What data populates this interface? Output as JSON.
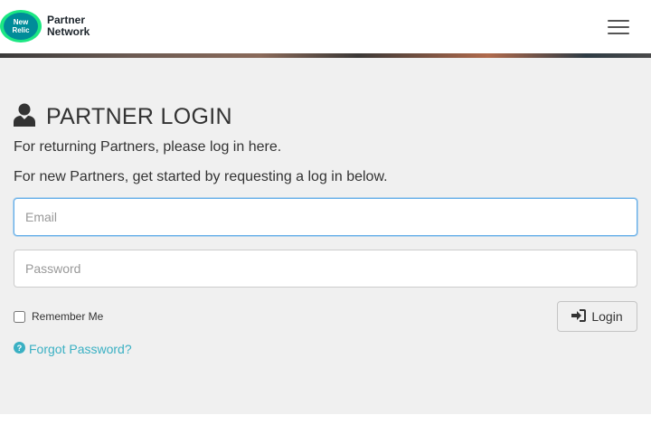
{
  "header": {
    "logo": {
      "badge_line1": "New",
      "badge_line2": "Relic",
      "name_line1": "Partner",
      "name_line2": "Network"
    },
    "menu_icon": "hamburger-menu-icon"
  },
  "login": {
    "title": "PARTNER LOGIN",
    "title_icon": "user-icon",
    "intro_returning": "For returning Partners, please log in here.",
    "intro_new": "For new Partners, get started by requesting a log in below.",
    "email_placeholder": "Email",
    "password_placeholder": "Password",
    "remember_label": "Remember Me",
    "remember_checked": false,
    "login_button": "Login",
    "login_icon": "sign-in-icon",
    "forgot_label": "Forgot Password?",
    "forgot_icon": "question-circle-icon"
  },
  "colors": {
    "link": "#3ab0c3",
    "focus_border": "#66afe9",
    "page_bg": "#f0f0f0",
    "logo_teal": "#1ce783",
    "logo_dark": "#008c99"
  }
}
